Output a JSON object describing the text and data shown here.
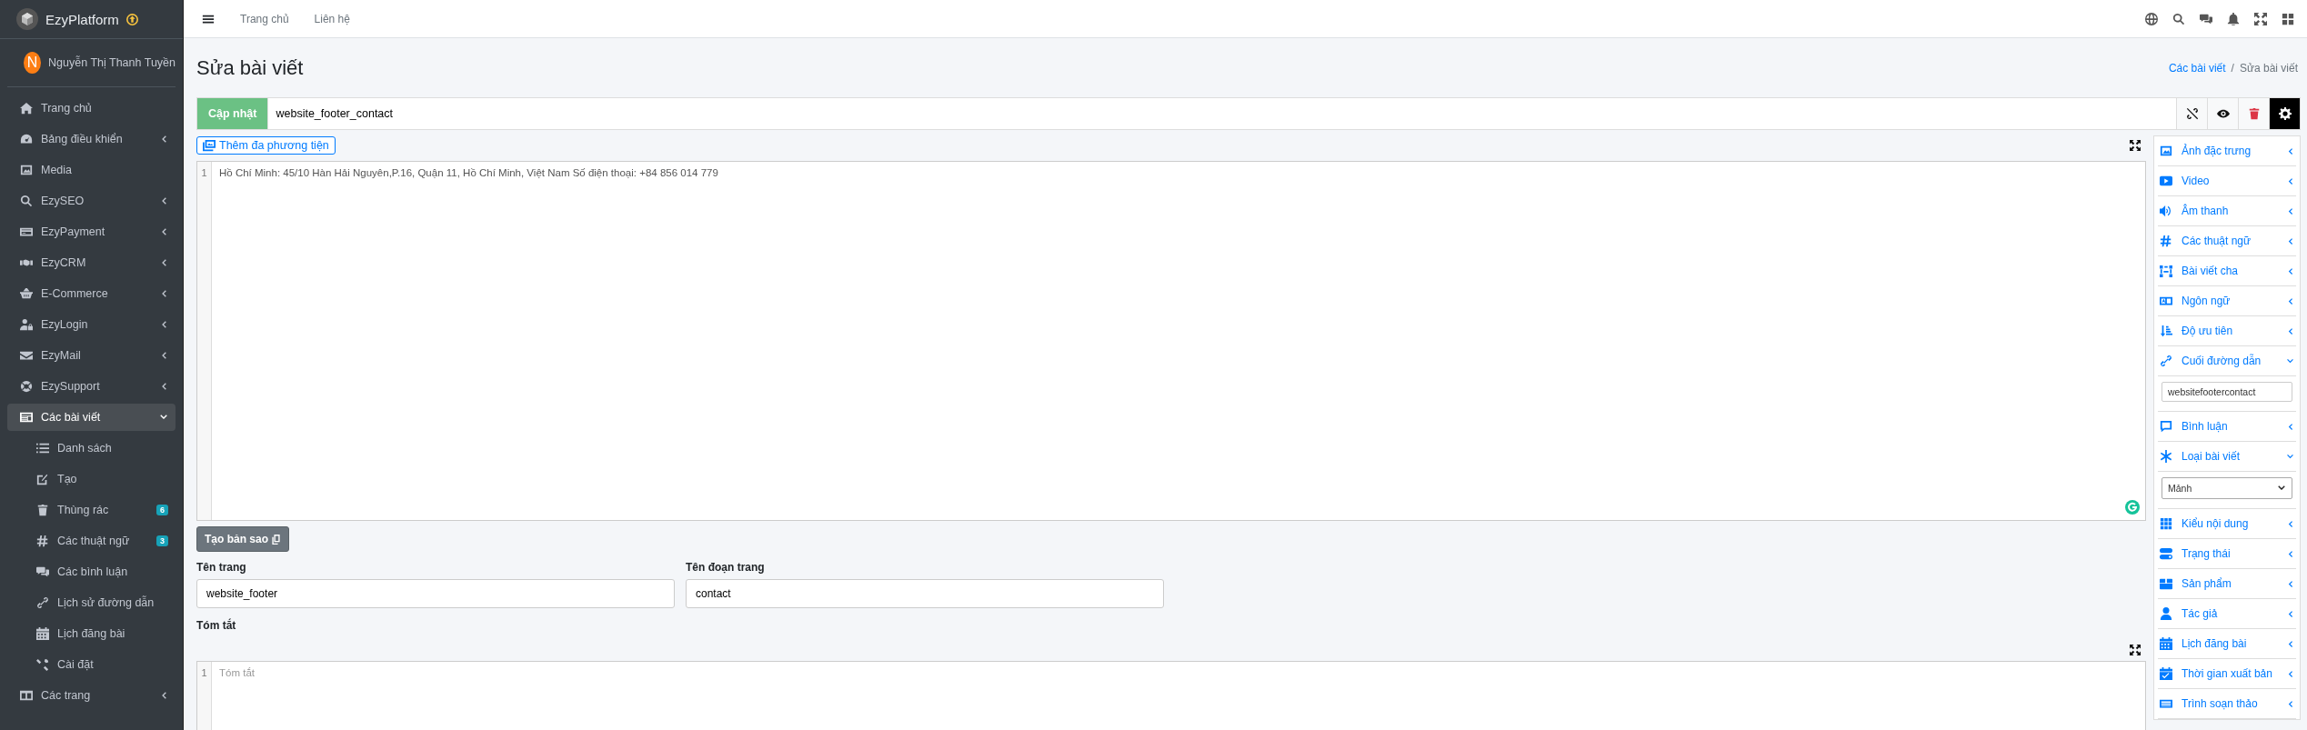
{
  "brand": {
    "name": "EzyPlatform"
  },
  "user": {
    "initial": "N",
    "name": "Nguyễn Thị Thanh Tuyền"
  },
  "sidebar": {
    "items": [
      {
        "label": "Trang chủ",
        "selected": false
      },
      {
        "label": "Bảng điều khiển",
        "selected": false,
        "expanded": false
      },
      {
        "label": "Media",
        "selected": false
      },
      {
        "label": "EzySEO",
        "selected": false,
        "expanded": false
      },
      {
        "label": "EzyPayment",
        "selected": false,
        "expanded": false
      },
      {
        "label": "EzyCRM",
        "selected": false,
        "expanded": false
      },
      {
        "label": "E-Commerce",
        "selected": false,
        "expanded": false
      },
      {
        "label": "EzyLogin",
        "selected": false,
        "expanded": false
      },
      {
        "label": "EzyMail",
        "selected": false,
        "expanded": false
      },
      {
        "label": "EzySupport",
        "selected": false,
        "expanded": false
      },
      {
        "label": "Các bài viết",
        "selected": true,
        "expanded": true,
        "children": [
          {
            "label": "Danh sách",
            "selected": false
          },
          {
            "label": "Tạo",
            "selected": false
          },
          {
            "label": "Thùng rác",
            "selected": false,
            "badge": "6"
          },
          {
            "label": "Các thuật ngữ",
            "selected": false,
            "badge": "3"
          },
          {
            "label": "Các bình luận",
            "selected": false
          },
          {
            "label": "Lịch sử đường dẫn",
            "selected": false
          },
          {
            "label": "Lịch đăng bài",
            "selected": false
          },
          {
            "label": "Cài đặt",
            "selected": false
          }
        ]
      },
      {
        "label": "Các trang",
        "selected": false,
        "expanded": false
      }
    ]
  },
  "top_nav": {
    "links": [
      "Trang chủ",
      "Liên hệ"
    ]
  },
  "page": {
    "title": "Sửa bài viết",
    "breadcrumb": [
      {
        "label": "Các bài viết",
        "kind": "link"
      },
      {
        "label": "/",
        "kind": "separator"
      },
      {
        "label": "Sửa bài viết",
        "kind": "current"
      }
    ]
  },
  "toolbar": {
    "update_button": "Cập nhật",
    "title_value": "website_footer_contact",
    "actions": [
      {
        "selected": false
      },
      {
        "selected": false
      },
      {
        "selected": false
      },
      {
        "selected": true
      }
    ]
  },
  "media_button": "Thêm đa phương tiện",
  "editor": {
    "lines": [
      {
        "number": "1",
        "text": "Hồ Chí Minh: 45/10 Hàn Hải Nguyên,P.16, Quận 11, Hồ Chí Minh, Việt Nam Số điện thoại: +84 856 014 779"
      }
    ]
  },
  "copy_button": "Tạo bản sao",
  "fields": [
    {
      "label": "Tên trang",
      "value": "website_footer"
    },
    {
      "label": "Tên đoạn trang",
      "value": "contact"
    }
  ],
  "summary": {
    "label": "Tóm tắt",
    "line_number": "1",
    "placeholder": "Tóm tắt"
  },
  "right_panel": {
    "items": [
      {
        "label": "Ảnh đặc trưng",
        "expanded": false
      },
      {
        "label": "Video",
        "expanded": false
      },
      {
        "label": "Âm thanh",
        "expanded": false
      },
      {
        "label": "Các thuật ngữ",
        "expanded": false
      },
      {
        "label": "Bài viết cha",
        "expanded": false
      },
      {
        "label": "Ngôn ngữ",
        "expanded": false
      },
      {
        "label": "Độ ưu tiên",
        "expanded": false
      },
      {
        "label": "Cuối đường dẫn",
        "expanded": true,
        "kind": "text-field",
        "value": "websitefootercontact"
      },
      {
        "label": "Bình luận",
        "expanded": false
      },
      {
        "label": "Loại bài viết",
        "expanded": true,
        "kind": "select",
        "value": "Mảnh"
      },
      {
        "label": "Kiểu nội dung",
        "expanded": false
      },
      {
        "label": "Trạng thái",
        "expanded": false
      },
      {
        "label": "Sản phẩm",
        "expanded": false
      },
      {
        "label": "Tác giả",
        "expanded": false
      },
      {
        "label": "Lịch đăng bài",
        "expanded": false
      },
      {
        "label": "Thời gian xuất bản",
        "expanded": false
      },
      {
        "label": "Trình soạn thảo",
        "expanded": false
      }
    ]
  }
}
